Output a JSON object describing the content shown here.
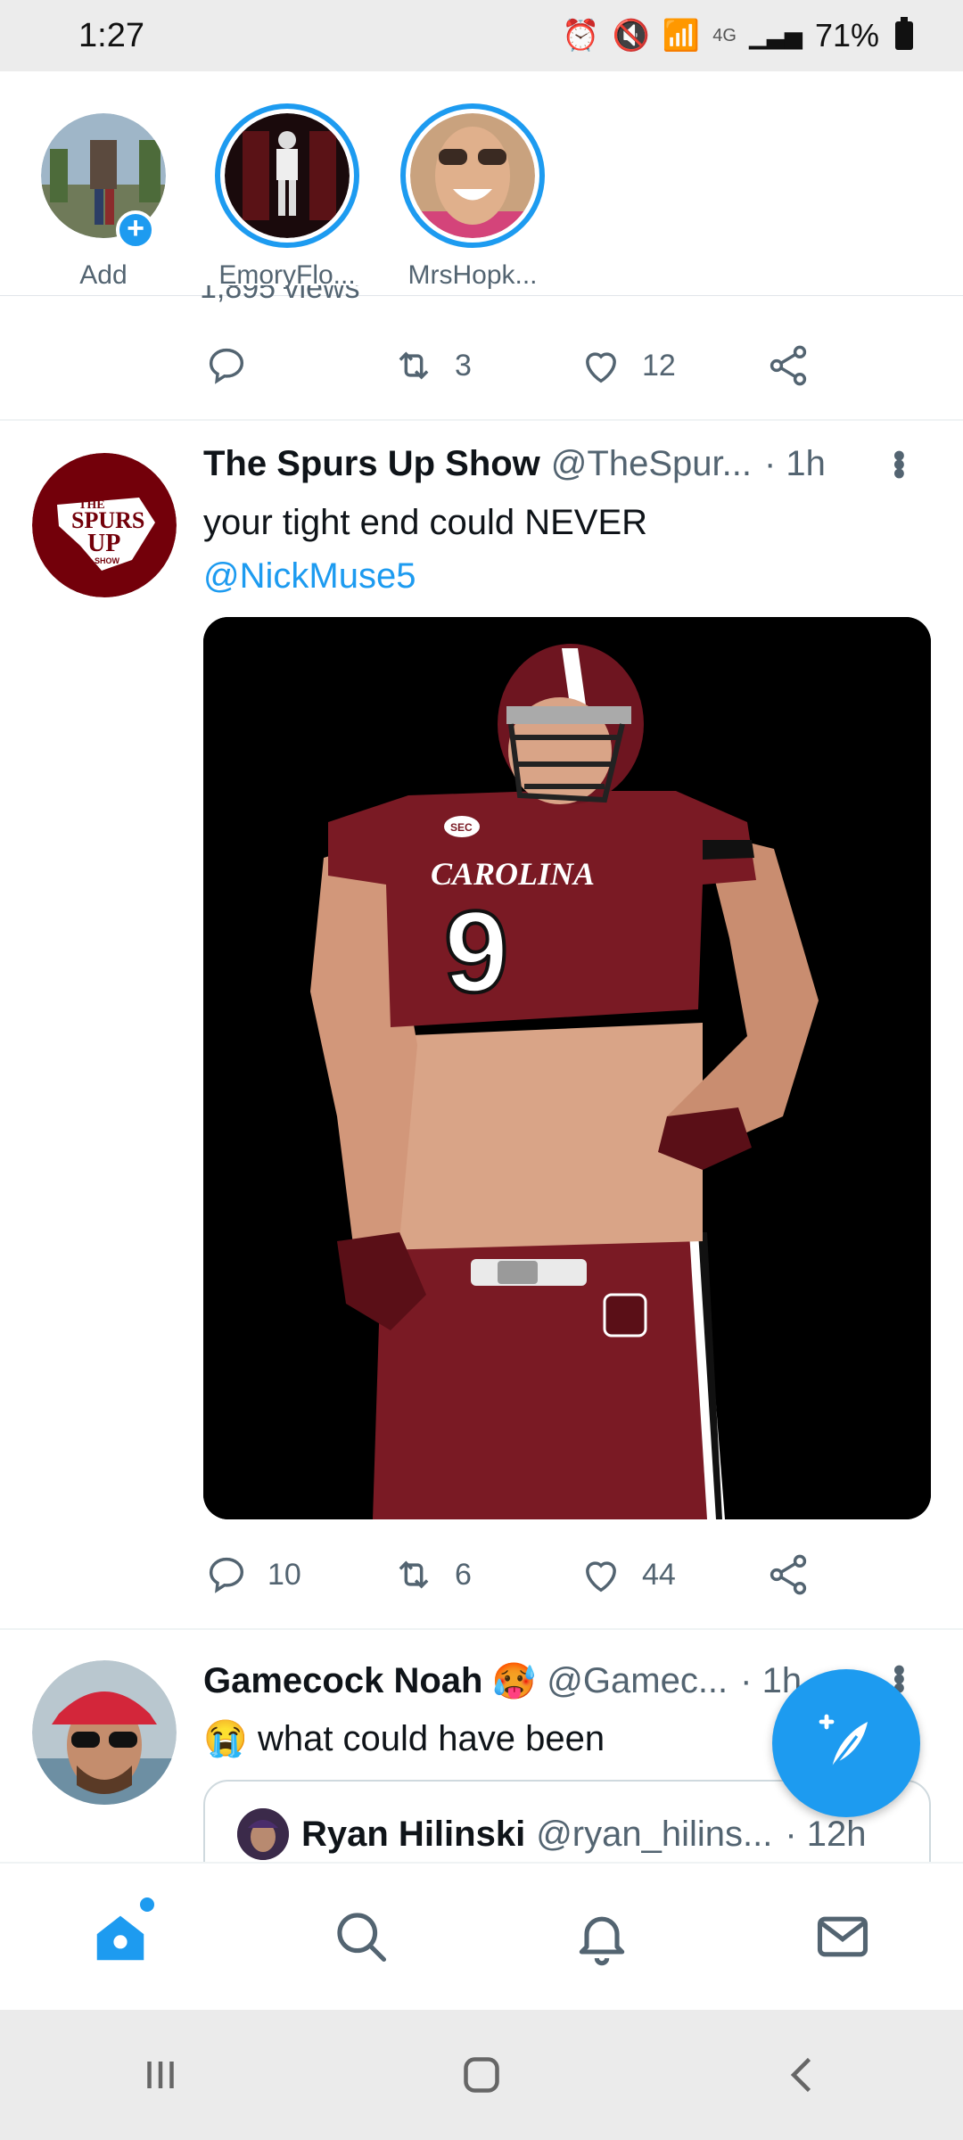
{
  "status_bar": {
    "time": "1:27",
    "network": "4G",
    "battery": "71%",
    "icons": [
      "alarm-icon",
      "mute-icon",
      "wifi-icon",
      "signal-icon",
      "battery-icon"
    ]
  },
  "fleets": [
    {
      "label": "Add",
      "active": false
    },
    {
      "label": "EmoryFlo...",
      "active": true
    },
    {
      "label": "MrsHopk...",
      "active": true
    }
  ],
  "previous_tweet": {
    "views_partial": "1,895 views",
    "retweets": "3",
    "likes": "12"
  },
  "tweets": [
    {
      "name": "The Spurs Up Show",
      "handle": "@TheSpur...",
      "time": "· 1h",
      "text": "your tight end could NEVER",
      "mention": "@NickMuse5",
      "avatar_text": [
        "THE",
        "SPURS",
        "UP",
        "SHOW"
      ],
      "media_text": {
        "jersey_name": "CAROLINA",
        "jersey_number": "9",
        "patch": "SEC"
      },
      "replies": "10",
      "retweets": "6",
      "likes": "44"
    },
    {
      "name": "Gamecock Noah",
      "handle": "@Gamec...",
      "time": "· 1h",
      "emoji_after_name": "🥵",
      "text_emoji": "😭",
      "text": "what could have been",
      "quote": {
        "name": "Ryan Hilinski",
        "handle": "@ryan_hilins...",
        "time": "· 12h"
      }
    }
  ],
  "bottom_nav": [
    "home-icon",
    "search-icon",
    "notifications-icon",
    "messages-icon"
  ],
  "colors": {
    "accent": "#1d9bf0",
    "text": "#0f1419",
    "secondary": "#536471",
    "garnet": "#73000a"
  }
}
